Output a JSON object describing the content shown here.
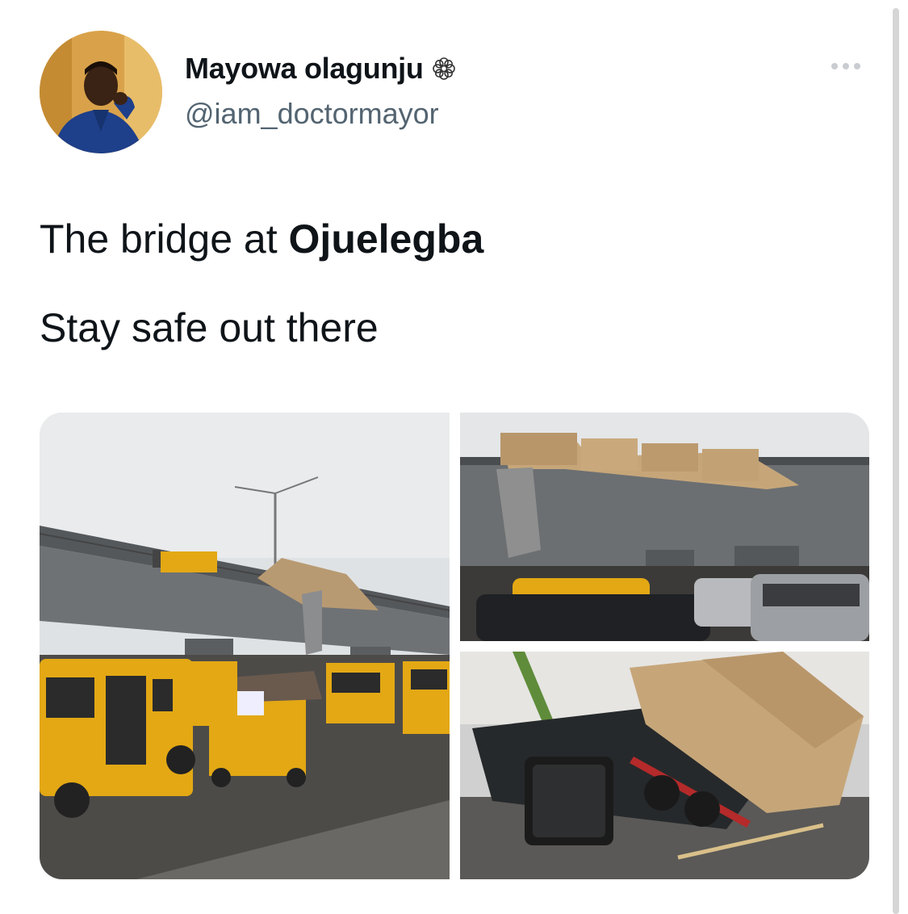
{
  "tweet": {
    "author_name": "Mayowa olagunju",
    "handle": "@iam_doctormayor",
    "text_prefix": "The bridge at ",
    "text_bold": "Ojuelegba",
    "text_line2": "Stay safe out there"
  },
  "icons": {
    "name_badge": "flower-icon",
    "menu": "more-options-icon"
  },
  "media": {
    "count": 3
  },
  "colors": {
    "text_primary": "#0f1419",
    "text_secondary": "#536471",
    "danfo_yellow": "#e3a814"
  }
}
